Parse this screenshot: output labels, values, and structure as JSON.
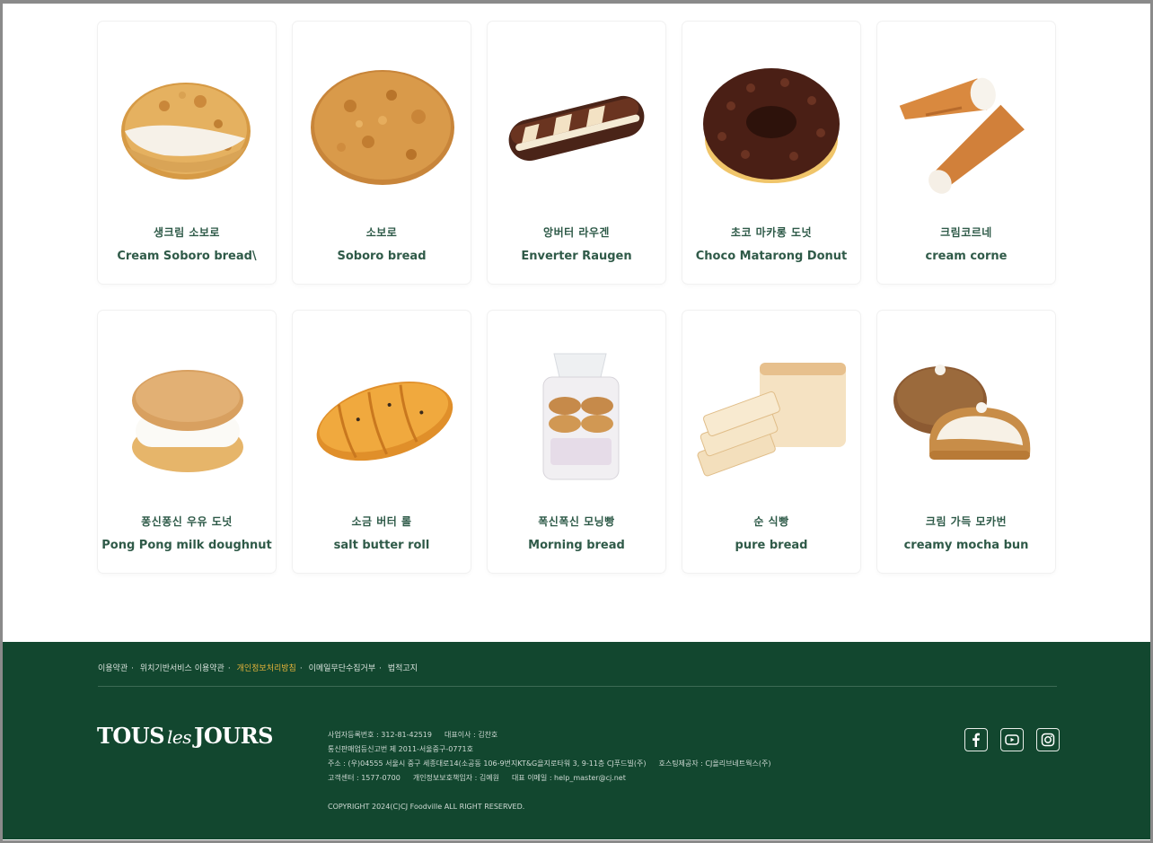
{
  "products": [
    [
      {
        "korean": "생크림 소보로",
        "english": "Cream Soboro bread\\",
        "icon": "cream-soboro"
      },
      {
        "korean": "소보로",
        "english": "Soboro bread",
        "icon": "soboro"
      },
      {
        "korean": "앙버터 라우겐",
        "english": "Enverter Raugen",
        "icon": "raugen"
      },
      {
        "korean": "초코 마카롱 도넛",
        "english": "Choco Matarong Donut",
        "icon": "choco-donut"
      },
      {
        "korean": "크림코르네",
        "english": "cream corne",
        "icon": "corne"
      }
    ],
    [
      {
        "korean": "퐁신퐁신 우유 도넛",
        "english": "Pong Pong milk doughnut",
        "icon": "milk-doughnut"
      },
      {
        "korean": "소금 버터 롤",
        "english": "salt butter roll",
        "icon": "salt-roll"
      },
      {
        "korean": "폭신폭신 모닝빵",
        "english": "Morning bread",
        "icon": "morning-bread"
      },
      {
        "korean": "순 식빵",
        "english": "pure bread",
        "icon": "pure-bread"
      },
      {
        "korean": "크림 가득 모카번",
        "english": "creamy mocha bun",
        "icon": "mocha-bun"
      }
    ]
  ],
  "footer": {
    "links": [
      "이용약관",
      "위치기반서비스 이용약관",
      "개인정보처리방침",
      "이메일무단수집거부",
      "법적고지"
    ],
    "highlight_index": 2,
    "logo": {
      "left": "TOUS",
      "mid": "les",
      "right": "JOURS"
    },
    "info": {
      "line1a": "사업자등록번호 : 312-81-42519",
      "line1b": "대표이사 : 김찬호",
      "line2": "통신판매업등신고번 제 2011-서울중구-0771호",
      "line3a": "주소 : (우)04555 서울시 중구 세종대로14(소공동 106-9번지KT&G을지로타워 3, 9-11층 CJ푸드빌(주)",
      "line3b": "호스팅제공자 : CJ올리브네트웍스(주)",
      "line4a": "고객센터 : 1577-0700",
      "line4b": "개인정보보호책임자 : 김예원",
      "line4c": "대표 이메일 : help_master@cj.net"
    },
    "copyright": "COPYRIGHT 2024(C)CJ Foodville ALL RIGHT RESERVED.",
    "social": [
      "facebook-icon",
      "youtube-icon",
      "instagram-icon"
    ]
  },
  "colors": {
    "footer_bg": "#12472f",
    "text_green": "#2f5a48",
    "highlight": "#e7b43a"
  }
}
